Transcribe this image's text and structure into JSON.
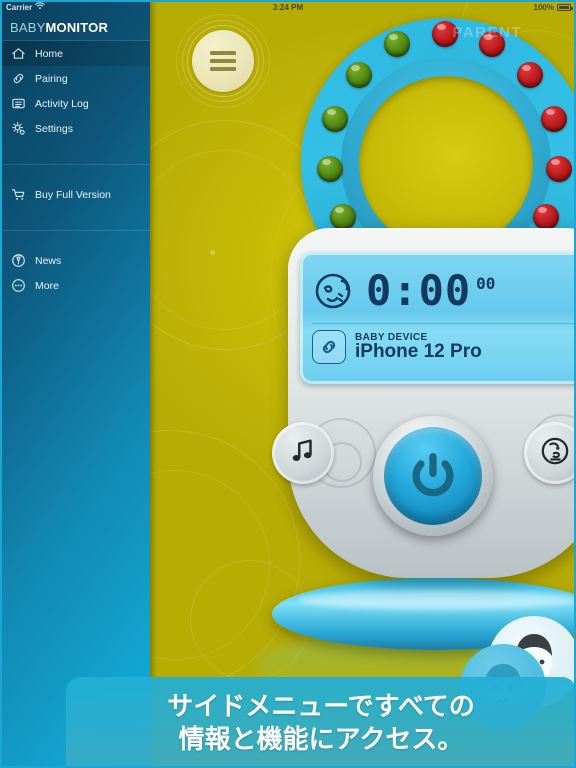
{
  "status_bar": {
    "carrier": "Carrier",
    "wifi_icon": "wifi-icon",
    "time": "3:24 PM",
    "battery_percent": "100%",
    "battery_icon": "battery-full-icon"
  },
  "sidebar": {
    "brand_light": "BABY",
    "brand_bold": "MONITOR",
    "items": [
      {
        "label": "Home",
        "icon": "home-icon",
        "active": true
      },
      {
        "label": "Pairing",
        "icon": "link-icon",
        "active": false
      },
      {
        "label": "Activity Log",
        "icon": "list-icon",
        "active": false
      },
      {
        "label": "Settings",
        "icon": "gear-icon",
        "active": false
      },
      {
        "label": "Buy Full Version",
        "icon": "cart-icon",
        "active": false
      },
      {
        "label": "News",
        "icon": "broadcast-icon",
        "active": false
      },
      {
        "label": "More",
        "icon": "ellipsis-icon",
        "active": false
      }
    ]
  },
  "main": {
    "menu_button_icon": "hamburger-menu-icon",
    "device": {
      "lcd": {
        "baby_icon": "sleeping-baby-icon",
        "timer_main": "0:00",
        "timer_seconds": "00",
        "link_icon": "link-chain-icon",
        "device_label": "BABY DEVICE",
        "device_name": "iPhone 12 Pro"
      },
      "music_button_icon": "music-note-icon",
      "power_button_icon": "power-icon",
      "talk_button_icon": "talk-face-icon",
      "leds": [
        "red",
        "red",
        "red",
        "red",
        "red",
        "red",
        "red",
        "green",
        "green",
        "green",
        "green",
        "green"
      ]
    },
    "parent_watermark": "PARENT",
    "avatar_back": "parent-avatar-man",
    "avatar_front": "parent-avatar-woman"
  },
  "caption": {
    "line1": "サイドメニューですべての",
    "line2": "情報と機能にアクセス。"
  },
  "colors": {
    "sidebar_dark": "#0a3e5c",
    "sidebar_light": "#0fa8d2",
    "stage_yellow": "#c6ba06",
    "accent_cyan": "#23a8dc",
    "caption_bg": "#20afd7",
    "led_red": "#b8191c",
    "led_green": "#4c8512"
  }
}
